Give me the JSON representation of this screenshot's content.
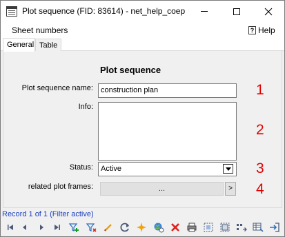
{
  "window": {
    "title": "Plot sequence (FID: 83614) - net_help_coep"
  },
  "menu": {
    "sheet_numbers": "Sheet numbers",
    "help": "Help"
  },
  "tabs": [
    {
      "label": "General",
      "selected": true
    },
    {
      "label": "Table",
      "selected": false
    }
  ],
  "form": {
    "heading": "Plot sequence",
    "name_label": "Plot sequence name:",
    "name_value": "construction plan",
    "info_label": "Info:",
    "info_value": "",
    "status_label": "Status:",
    "status_value": "Active",
    "frames_label": "related plot frames:",
    "frames_button": "...",
    "frames_arrow": ">"
  },
  "annotations": [
    "1",
    "2",
    "3",
    "4"
  ],
  "status": {
    "record_text": "Record 1 of 1 (Filter active)"
  },
  "toolbar": {
    "icons": [
      "first-record-icon",
      "previous-record-icon",
      "next-record-icon",
      "last-record-icon",
      "add-filter-icon",
      "filter-icon",
      "edit-icon",
      "refresh-icon",
      "new-icon",
      "globe-icon",
      "delete-icon",
      "print-icon",
      "select-icon",
      "select-all-icon",
      "sequence-icon",
      "table-icon",
      "exit-icon"
    ]
  },
  "colors": {
    "annotation": "#e30000",
    "record_text": "#1a3fbf"
  }
}
